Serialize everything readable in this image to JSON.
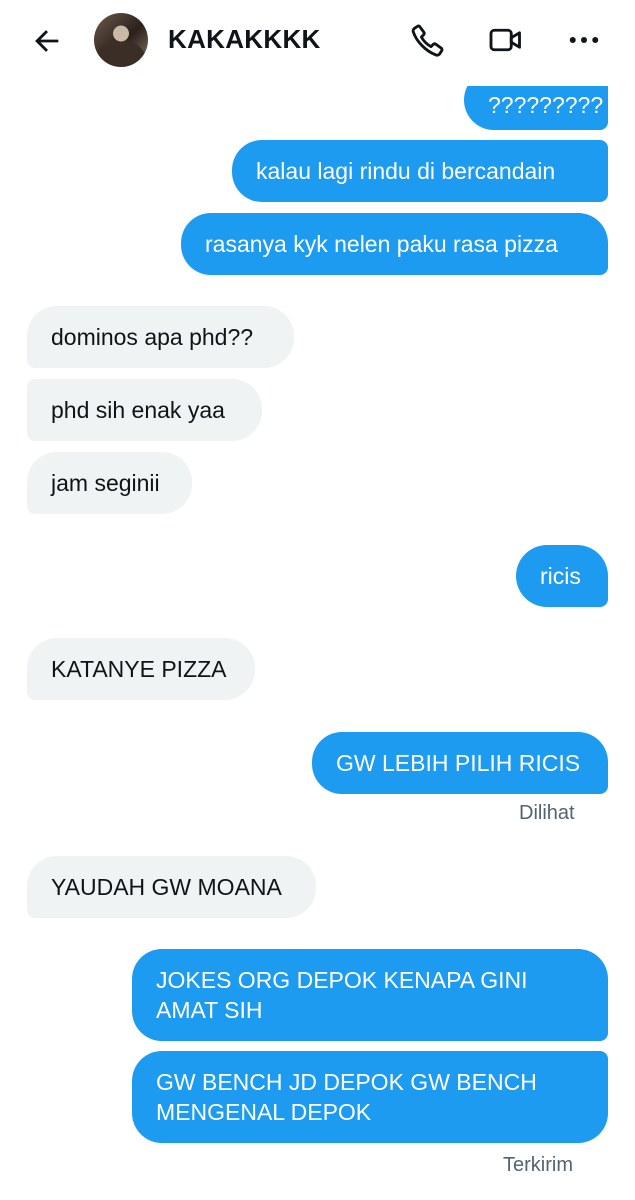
{
  "header": {
    "contact_name": "KAKAKKKK",
    "icons": [
      "back-arrow-icon",
      "phone-icon",
      "video-call-icon",
      "more-icon"
    ]
  },
  "messages": [
    {
      "from": "me",
      "text": "?????????"
    },
    {
      "from": "me",
      "text": "kalau lagi rindu di bercandain"
    },
    {
      "from": "me",
      "text": "rasanya kyk nelen paku rasa pizza"
    },
    {
      "from": "them",
      "text": "dominos apa phd??"
    },
    {
      "from": "them",
      "text": "phd sih enak yaa"
    },
    {
      "from": "them",
      "text": "jam seginii"
    },
    {
      "from": "me",
      "text": "ricis"
    },
    {
      "from": "them",
      "text": "KATANYE PIZZA"
    },
    {
      "from": "me",
      "text": "GW LEBIH PILIH RICIS"
    },
    {
      "from": "them",
      "text": "YAUDAH GW MOANA"
    },
    {
      "from": "me",
      "text": "JOKES ORG DEPOK KENAPA GINI AMAT SIH"
    },
    {
      "from": "me",
      "text": "GW BENCH JD DEPOK GW BENCH MENGENAL DEPOK"
    }
  ],
  "status": {
    "seen": "Dilihat",
    "sent": "Terkirim"
  },
  "colors": {
    "outgoing_bubble": "#1d9bf0",
    "incoming_bubble": "#eff3f4",
    "status_text": "#536471"
  }
}
